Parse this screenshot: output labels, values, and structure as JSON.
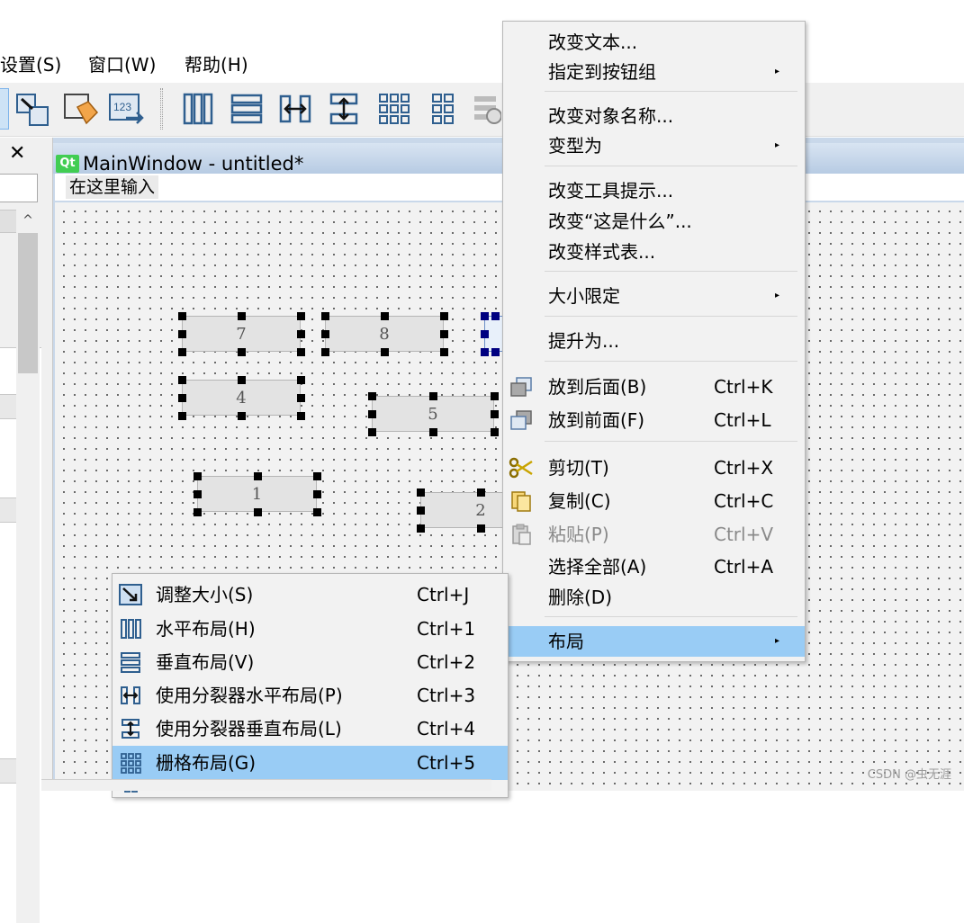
{
  "menubar": {
    "items": [
      "设置(S)",
      "窗口(W)",
      "帮助(H)"
    ]
  },
  "left_dock": {
    "close_glyph": "✕",
    "scroll_up_glyph": "^"
  },
  "form_window": {
    "title": "MainWindow - untitled*",
    "qt_badge": "Qt",
    "menu_placeholder": "在这里输入"
  },
  "widgets": [
    {
      "label": "7"
    },
    {
      "label": "8"
    },
    {
      "label": "4"
    },
    {
      "label": "5"
    },
    {
      "label": "1"
    },
    {
      "label": "2"
    }
  ],
  "context_menu": {
    "items": [
      {
        "label": "改变文本..."
      },
      {
        "label": "指定到按钮组",
        "arrow": "▸"
      },
      {
        "label": "改变对象名称..."
      },
      {
        "label": "变型为",
        "arrow": "▸"
      },
      {
        "label": "改变工具提示..."
      },
      {
        "label": "改变“这是什么”..."
      },
      {
        "label": "改变样式表..."
      },
      {
        "label": "大小限定",
        "arrow": "▸"
      },
      {
        "label": "提升为..."
      },
      {
        "label": "放到后面(B)",
        "shortcut": "Ctrl+K",
        "icon": "send-to-back-icon"
      },
      {
        "label": "放到前面(F)",
        "shortcut": "Ctrl+L",
        "icon": "bring-to-front-icon"
      },
      {
        "label": "剪切(T)",
        "shortcut": "Ctrl+X",
        "icon": "scissors-icon"
      },
      {
        "label": "复制(C)",
        "shortcut": "Ctrl+C",
        "icon": "copy-icon"
      },
      {
        "label": "粘贴(P)",
        "shortcut": "Ctrl+V",
        "icon": "paste-icon",
        "disabled": true
      },
      {
        "label": "选择全部(A)",
        "shortcut": "Ctrl+A"
      },
      {
        "label": "删除(D)"
      },
      {
        "label": "布局",
        "arrow": "▸",
        "highlighted": true
      }
    ]
  },
  "layout_submenu": {
    "items": [
      {
        "label": "调整大小(S)",
        "shortcut": "Ctrl+J",
        "icon": "adjust-size-icon"
      },
      {
        "label": "水平布局(H)",
        "shortcut": "Ctrl+1",
        "icon": "horizontal-layout-icon"
      },
      {
        "label": "垂直布局(V)",
        "shortcut": "Ctrl+2",
        "icon": "vertical-layout-icon"
      },
      {
        "label": "使用分裂器水平布局(P)",
        "shortcut": "Ctrl+3",
        "icon": "horizontal-splitter-icon"
      },
      {
        "label": "使用分裂器垂直布局(L)",
        "shortcut": "Ctrl+4",
        "icon": "vertical-splitter-icon"
      },
      {
        "label": "栅格布局(G)",
        "shortcut": "Ctrl+5",
        "icon": "grid-layout-icon",
        "highlighted": true
      }
    ]
  },
  "watermark": "CSDN @虫无涯",
  "colors": {
    "highlight": "#99ccf5",
    "qt_green": "#41cd52",
    "layout_icon_blue": "#2f5f8f"
  }
}
